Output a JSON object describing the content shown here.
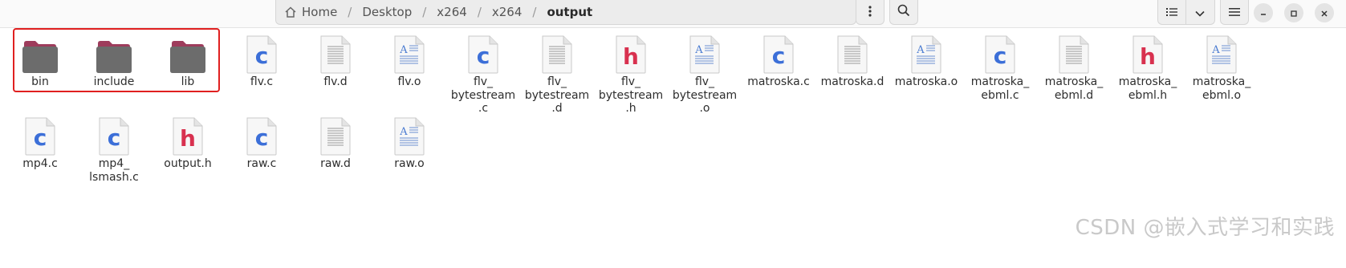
{
  "window": {
    "breadcrumbs": [
      "Home",
      "Desktop",
      "x264",
      "x264",
      "output"
    ]
  },
  "files": [
    {
      "name": "bin",
      "type": "folder"
    },
    {
      "name": "include",
      "type": "folder"
    },
    {
      "name": "lib",
      "type": "folder"
    },
    {
      "name": "flv.c",
      "type": "c"
    },
    {
      "name": "flv.d",
      "type": "d"
    },
    {
      "name": "flv.o",
      "type": "o"
    },
    {
      "name": "flv_\nbytestream\n.c",
      "type": "c"
    },
    {
      "name": "flv_\nbytestream\n.d",
      "type": "d"
    },
    {
      "name": "flv_\nbytestream\n.h",
      "type": "h"
    },
    {
      "name": "flv_\nbytestream\n.o",
      "type": "o"
    },
    {
      "name": "matroska.c",
      "type": "c"
    },
    {
      "name": "matroska.d",
      "type": "d"
    },
    {
      "name": "matroska.o",
      "type": "o"
    },
    {
      "name": "matroska_\nebml.c",
      "type": "c"
    },
    {
      "name": "matroska_\nebml.d",
      "type": "d"
    },
    {
      "name": "matroska_\nebml.h",
      "type": "h"
    },
    {
      "name": "matroska_\nebml.o",
      "type": "o"
    },
    {
      "name": "mp4.c",
      "type": "c"
    },
    {
      "name": "mp4_\nlsmash.c",
      "type": "c"
    },
    {
      "name": "output.h",
      "type": "h"
    },
    {
      "name": "raw.c",
      "type": "c"
    },
    {
      "name": "raw.d",
      "type": "d"
    },
    {
      "name": "raw.o",
      "type": "o"
    }
  ],
  "watermark": "CSDN @嵌入式学习和实践",
  "colors": {
    "folder": "#6c6c6c",
    "folder_tab": "#9e3c5c",
    "c_letter": "#3c6fd8",
    "h_letter": "#d8314f",
    "highlight": "#e02020"
  }
}
